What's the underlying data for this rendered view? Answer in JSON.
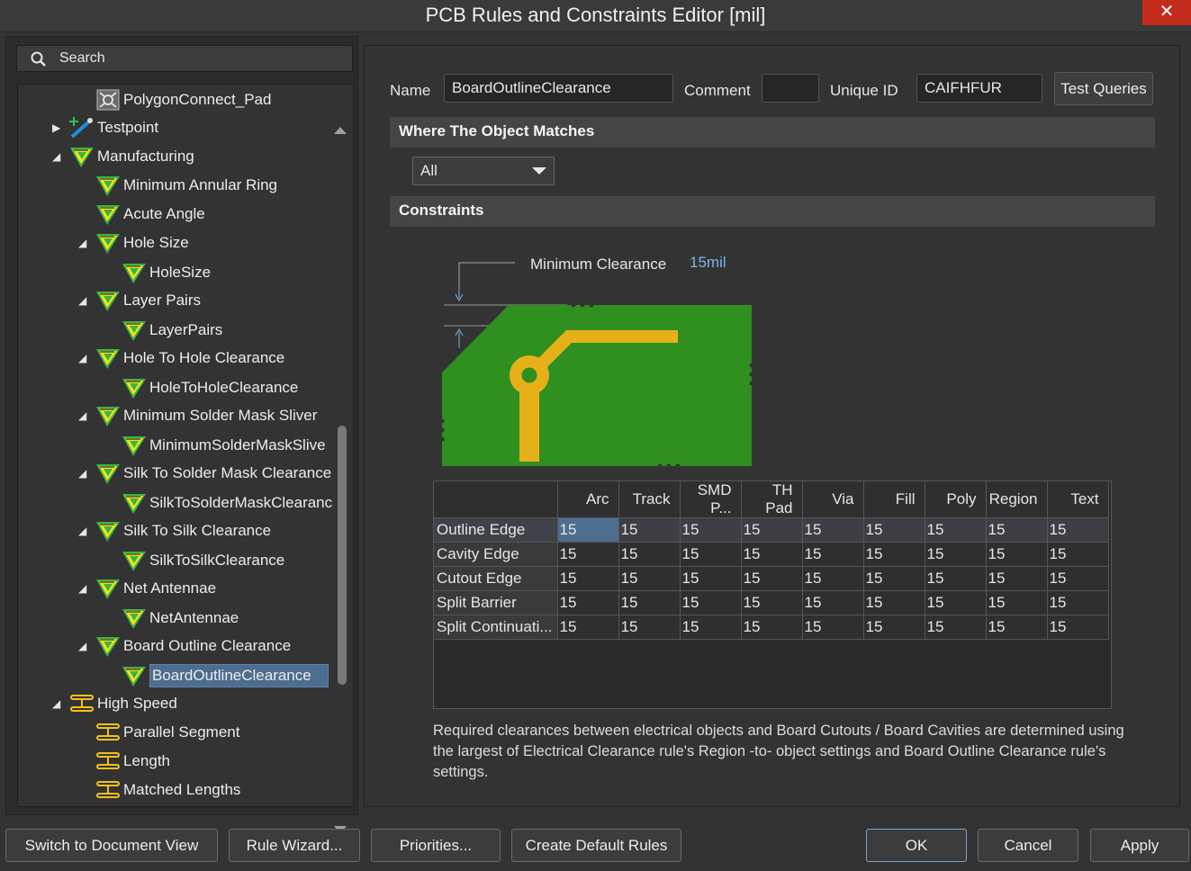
{
  "window": {
    "title": "PCB Rules and Constraints Editor [mil]",
    "close": "✕"
  },
  "search": {
    "placeholder": "Search"
  },
  "tree": {
    "items": [
      {
        "label": "PolygonConnect_Pad",
        "icon": "polygon-connect-icon"
      },
      {
        "label": "Testpoint",
        "icon": "testpoint-icon"
      },
      {
        "label": "Manufacturing",
        "icon": "manufacturing-icon"
      },
      {
        "label": "Minimum Annular Ring",
        "icon": "rule-icon"
      },
      {
        "label": "Acute Angle",
        "icon": "rule-icon"
      },
      {
        "label": "Hole Size",
        "icon": "rule-icon"
      },
      {
        "label": "HoleSize",
        "icon": "rule-icon"
      },
      {
        "label": "Layer Pairs",
        "icon": "rule-icon"
      },
      {
        "label": "LayerPairs",
        "icon": "rule-icon"
      },
      {
        "label": "Hole To Hole Clearance",
        "icon": "rule-icon"
      },
      {
        "label": "HoleToHoleClearance",
        "icon": "rule-icon"
      },
      {
        "label": "Minimum Solder Mask Sliver",
        "icon": "rule-icon"
      },
      {
        "label": "MinimumSolderMaskSlive",
        "icon": "rule-icon"
      },
      {
        "label": "Silk To Solder Mask Clearance",
        "icon": "rule-icon"
      },
      {
        "label": "SilkToSolderMaskClearanc",
        "icon": "rule-icon"
      },
      {
        "label": "Silk To Silk Clearance",
        "icon": "rule-icon"
      },
      {
        "label": "SilkToSilkClearance",
        "icon": "rule-icon"
      },
      {
        "label": "Net Antennae",
        "icon": "rule-icon"
      },
      {
        "label": "NetAntennae",
        "icon": "rule-icon"
      },
      {
        "label": "Board Outline Clearance",
        "icon": "rule-icon"
      },
      {
        "label": "BoardOutlineClearance",
        "icon": "rule-icon"
      },
      {
        "label": "High Speed",
        "icon": "high-speed-icon"
      },
      {
        "label": "Parallel Segment",
        "icon": "high-speed-icon"
      },
      {
        "label": "Length",
        "icon": "high-speed-icon"
      },
      {
        "label": "Matched Lengths",
        "icon": "high-speed-icon"
      }
    ]
  },
  "form": {
    "name_label": "Name",
    "name_value": "BoardOutlineClearance",
    "comment_label": "Comment",
    "comment_value": "",
    "uid_label": "Unique ID",
    "uid_value": "CAIFHFUR",
    "test_queries": "Test Queries"
  },
  "where": {
    "header": "Where The Object Matches",
    "scope": "All"
  },
  "constraints": {
    "header": "Constraints",
    "min_clearance_label": "Minimum Clearance",
    "min_clearance_value": "15mil",
    "columns": [
      "Arc",
      "Track",
      "SMD P...",
      "TH Pad",
      "Via",
      "Fill",
      "Poly",
      "Region",
      "Text"
    ],
    "rows": [
      {
        "name": "Outline Edge",
        "values": [
          "15",
          "15",
          "15",
          "15",
          "15",
          "15",
          "15",
          "15",
          "15"
        ]
      },
      {
        "name": "Cavity Edge",
        "values": [
          "15",
          "15",
          "15",
          "15",
          "15",
          "15",
          "15",
          "15",
          "15"
        ]
      },
      {
        "name": "Cutout Edge",
        "values": [
          "15",
          "15",
          "15",
          "15",
          "15",
          "15",
          "15",
          "15",
          "15"
        ]
      },
      {
        "name": "Split Barrier",
        "values": [
          "15",
          "15",
          "15",
          "15",
          "15",
          "15",
          "15",
          "15",
          "15"
        ]
      },
      {
        "name": "Split Continuati...",
        "values": [
          "15",
          "15",
          "15",
          "15",
          "15",
          "15",
          "15",
          "15",
          "15"
        ]
      }
    ],
    "description": "Required clearances between electrical objects and Board Cutouts / Board Cavities are determined using the largest of Electrical Clearance rule's Region -to- object settings and Board Outline Clearance rule's settings."
  },
  "buttons": {
    "switch_view": "Switch to Document View",
    "rule_wizard": "Rule Wizard...",
    "priorities": "Priorities...",
    "create_default": "Create Default Rules",
    "ok": "OK",
    "cancel": "Cancel",
    "apply": "Apply"
  },
  "colors": {
    "board_green": "#2f8f1f",
    "copper_yellow": "#e6b118",
    "selection_blue": "#4d6d8f",
    "clearance_value_blue": "#7fb2e8",
    "close_red": "#c42b1c"
  }
}
